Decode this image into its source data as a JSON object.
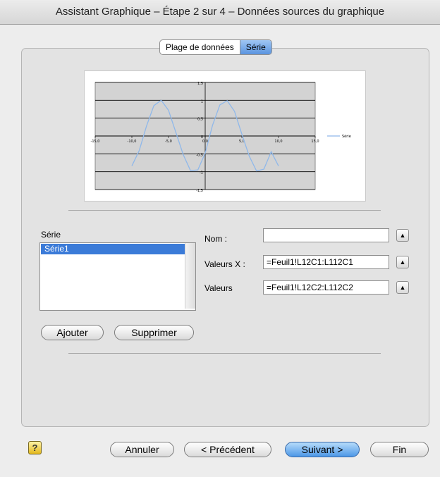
{
  "window": {
    "title": "Assistant Graphique – Étape 2 sur 4 – Données sources du graphique"
  },
  "tabs": [
    {
      "label": "Plage de données",
      "selected": false
    },
    {
      "label": "Série",
      "selected": true
    }
  ],
  "series_list": {
    "label": "Série",
    "items": [
      "Série1"
    ],
    "selected": "Série1"
  },
  "fields": {
    "name": {
      "label": "Nom :",
      "value": ""
    },
    "x_values": {
      "label": "Valeurs X :",
      "value": "=Feuil1!L12C1:L112C1"
    },
    "values": {
      "label": "Valeurs",
      "value": "=Feuil1!L12C2:L112C2"
    }
  },
  "buttons": {
    "add": "Ajouter",
    "remove": "Supprimer",
    "cancel": "Annuler",
    "previous": "< Précédent",
    "next": "Suivant >",
    "finish": "Fin",
    "help": "?"
  },
  "chart_data": {
    "type": "line",
    "x_ticks": [
      "-15,0",
      "-10,0",
      "-5,0",
      "0,0",
      "5,0",
      "10,0",
      "15,0"
    ],
    "y_ticks": [
      "1,5",
      "1",
      "0,5",
      "0",
      "-0,5",
      "-1",
      "-1,5"
    ],
    "xlim": [
      -15,
      15
    ],
    "ylim": [
      -1.5,
      1.5
    ],
    "legend": "top-right",
    "series": [
      {
        "name": "Série",
        "color": "#8fb8ea",
        "x": [
          -10,
          -9,
          -8,
          -7,
          -6,
          -5,
          -4,
          -3,
          -2,
          -1,
          0,
          1,
          2,
          3,
          4,
          5,
          6,
          7,
          8,
          9,
          10
        ],
        "y": [
          -0.84,
          -0.41,
          0.28,
          0.85,
          1.0,
          0.72,
          0.1,
          -0.52,
          -0.97,
          -0.95,
          -0.48,
          0.3,
          0.87,
          0.99,
          0.69,
          0.05,
          -0.56,
          -0.98,
          -0.93,
          -0.44,
          -0.84
        ]
      }
    ],
    "plot_background": "#d3d3d3",
    "grid": true
  }
}
